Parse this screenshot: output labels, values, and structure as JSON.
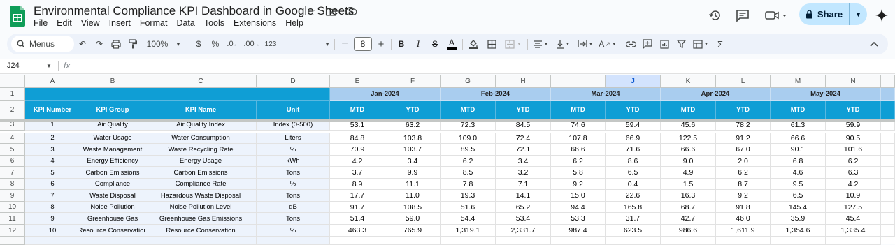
{
  "app": {
    "title": "Environmental Compliance KPI Dashboard in Google Sheets",
    "menu": [
      "File",
      "Edit",
      "View",
      "Insert",
      "Format",
      "Data",
      "Tools",
      "Extensions",
      "Help"
    ],
    "share_label": "Share",
    "accent": "#c2e7ff"
  },
  "toolbar": {
    "search_label": "Menus",
    "zoom": "100%",
    "currency": "$",
    "percent": "%",
    "decimal_less": ".0",
    "decimal_more": ".00",
    "number_format": "123",
    "font_size": "8"
  },
  "formula_bar": {
    "name_box": "J24",
    "fx": "fx"
  },
  "sheet": {
    "columns": [
      "A",
      "B",
      "C",
      "D",
      "E",
      "F",
      "G",
      "H",
      "I",
      "J",
      "K",
      "L",
      "M",
      "N"
    ],
    "selected_column": "J",
    "rows": [
      "1",
      "2",
      "3",
      "4",
      "5",
      "6",
      "7",
      "8",
      "9",
      "10",
      "11",
      "12",
      ""
    ],
    "months": [
      "Jan-2024",
      "Feb-2024",
      "Mar-2024",
      "Apr-2024",
      "May-2024"
    ],
    "headers": [
      "KPI Number",
      "KPI Group",
      "KPI Name",
      "Unit"
    ],
    "sub_headers": [
      "MTD",
      "YTD"
    ],
    "header_color": "#0f9ed5",
    "month_color": "#a9cdef",
    "data": [
      [
        "1",
        "Air Quality",
        "Air Quality Index",
        "Index (0-500)",
        "53.1",
        "63.2",
        "72.3",
        "84.5",
        "74.6",
        "59.4",
        "45.6",
        "78.2",
        "61.3",
        "59.9"
      ],
      [
        "2",
        "Water Usage",
        "Water Consumption",
        "Liters",
        "84.8",
        "103.8",
        "109.0",
        "72.4",
        "107.8",
        "66.9",
        "122.5",
        "91.2",
        "66.6",
        "90.5"
      ],
      [
        "3",
        "Waste Management",
        "Waste Recycling Rate",
        "%",
        "70.9",
        "103.7",
        "89.5",
        "72.1",
        "66.6",
        "71.6",
        "66.6",
        "67.0",
        "90.1",
        "101.6"
      ],
      [
        "4",
        "Energy Efficiency",
        "Energy Usage",
        "kWh",
        "4.2",
        "3.4",
        "6.2",
        "3.4",
        "6.2",
        "8.6",
        "9.0",
        "2.0",
        "6.8",
        "6.2"
      ],
      [
        "5",
        "Carbon Emissions",
        "Carbon Emissions",
        "Tons",
        "3.7",
        "9.9",
        "8.5",
        "3.2",
        "5.8",
        "6.5",
        "4.9",
        "6.2",
        "4.6",
        "6.3"
      ],
      [
        "6",
        "Compliance",
        "Compliance Rate",
        "%",
        "8.9",
        "11.1",
        "7.8",
        "7.1",
        "9.2",
        "0.4",
        "1.5",
        "8.7",
        "9.5",
        "4.2"
      ],
      [
        "7",
        "Waste Disposal",
        "Hazardous Waste Disposal",
        "Tons",
        "17.7",
        "11.0",
        "19.3",
        "14.1",
        "15.0",
        "22.6",
        "16.3",
        "9.2",
        "6.5",
        "10.9"
      ],
      [
        "8",
        "Noise Pollution",
        "Noise Pollution Level",
        "dB",
        "91.7",
        "108.5",
        "51.6",
        "65.2",
        "94.4",
        "165.8",
        "68.7",
        "91.8",
        "145.4",
        "127.5"
      ],
      [
        "9",
        "Greenhouse Gas",
        "Greenhouse Gas Emissions",
        "Tons",
        "51.4",
        "59.0",
        "54.4",
        "53.4",
        "53.3",
        "31.7",
        "42.7",
        "46.0",
        "35.9",
        "45.4"
      ],
      [
        "10",
        "Resource Conservation",
        "Resource Conservation",
        "%",
        "463.3",
        "765.9",
        "1,319.1",
        "2,331.7",
        "987.4",
        "623.5",
        "986.6",
        "1,611.9",
        "1,354.6",
        "1,335.4"
      ]
    ]
  }
}
